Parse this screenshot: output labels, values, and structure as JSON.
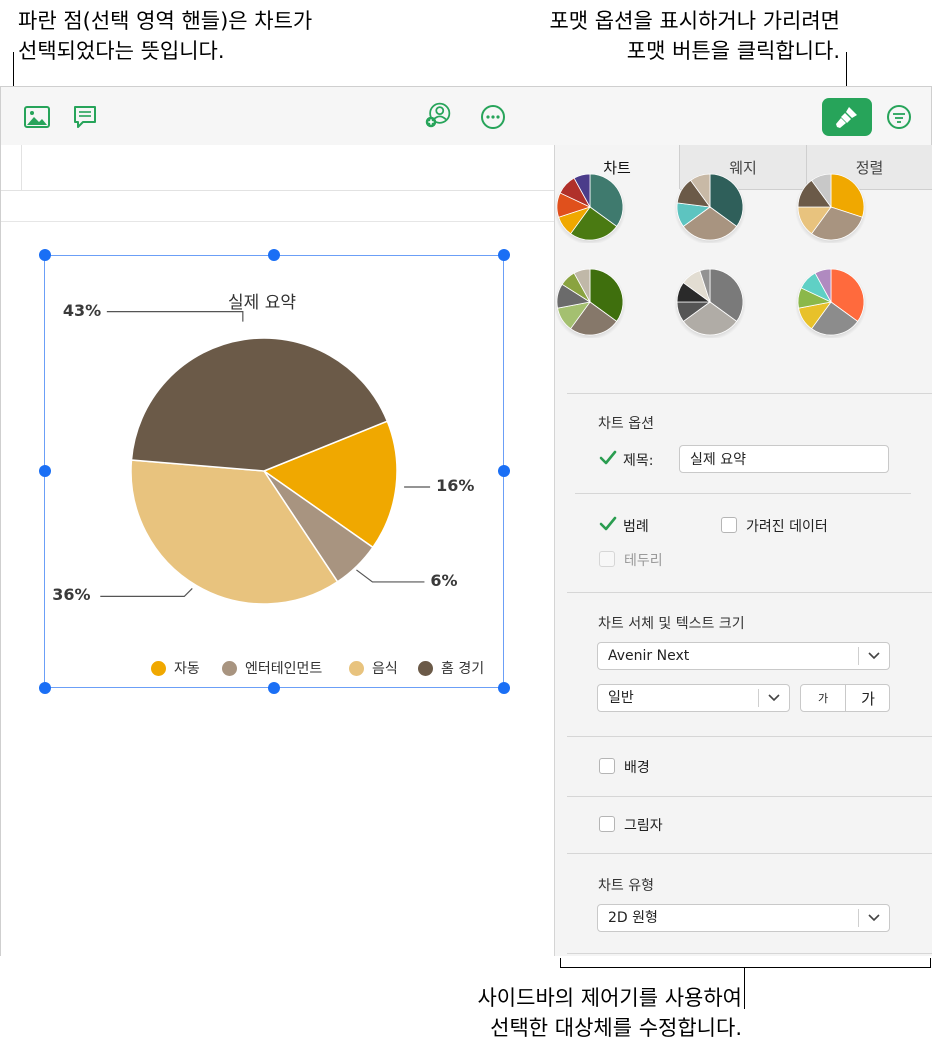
{
  "callouts": {
    "top_left": [
      "파란 점(선택 영역 핸들)은 차트가",
      "선택되었다는 뜻입니다."
    ],
    "top_right": [
      "포맷 옵션을 표시하거나 가리려면",
      "포맷 버튼을 클릭합니다."
    ],
    "bottom": [
      "사이드바의 제어기를 사용하여",
      "선택한 대상체를 수정합니다."
    ]
  },
  "toolbar": {
    "icons": [
      "media-icon",
      "comment-icon",
      "collaborate-icon",
      "more-icon",
      "format-brush-icon",
      "organize-icon"
    ],
    "accent": "#27a45a"
  },
  "chart_data": {
    "type": "pie",
    "title": "실제 요약",
    "categories": [
      "자동",
      "엔터테인먼트",
      "음식",
      "홈 경기"
    ],
    "values": [
      16,
      6,
      36,
      43
    ],
    "labels": [
      "16%",
      "6%",
      "36%",
      "43%"
    ],
    "colors": [
      "#f0a800",
      "#a89480",
      "#e8c37e",
      "#6b5a48"
    ],
    "legend": "bottom",
    "start_angle_deg": 23
  },
  "sidebar": {
    "tabs": [
      "차트",
      "웨지",
      "정렬"
    ],
    "active_tab": "차트",
    "chart_options": {
      "title": "차트 옵션",
      "title_checkbox_label": "제목:",
      "title_checked": true,
      "title_value": "실제 요약",
      "legend_label": "범례",
      "legend_checked": true,
      "hidden_data_label": "가려진 데이터",
      "hidden_data_checked": false,
      "border_label": "테두리",
      "border_checked": false
    },
    "font_section": {
      "title": "차트 서체 및 텍스트 크기",
      "font": "Avenir Next",
      "weight": "일반",
      "size_small": "가",
      "size_large": "가"
    },
    "background_label": "배경",
    "background_checked": false,
    "shadow_label": "그림자",
    "shadow_checked": false,
    "chart_type": {
      "title": "차트 유형",
      "value": "2D 원형"
    }
  },
  "style_palettes": [
    [
      "#3f7a6e",
      "#4a7a12",
      "#f0a800",
      "#e0501c",
      "#b0302a",
      "#4b3c8a"
    ],
    [
      "#2f5f5a",
      "#a89480",
      "#5dc4c0",
      "#6b5a48",
      "#c8b9a6"
    ],
    [
      "#f0a800",
      "#a89480",
      "#e8c37e",
      "#6b5a48",
      "#c8c8c8"
    ],
    [
      "#3f6f0d",
      "#86786a",
      "#a4c070",
      "#6b6b6b",
      "#8aa340",
      "#c0b8a8"
    ],
    [
      "#7a7a7a",
      "#b0aca6",
      "#555555",
      "#2a2a2a",
      "#e2ddd2",
      "#939393"
    ],
    [
      "#ff6a3d",
      "#8c8c8c",
      "#e8c12a",
      "#8bb84a",
      "#5fd0c5",
      "#b08ac0"
    ]
  ]
}
